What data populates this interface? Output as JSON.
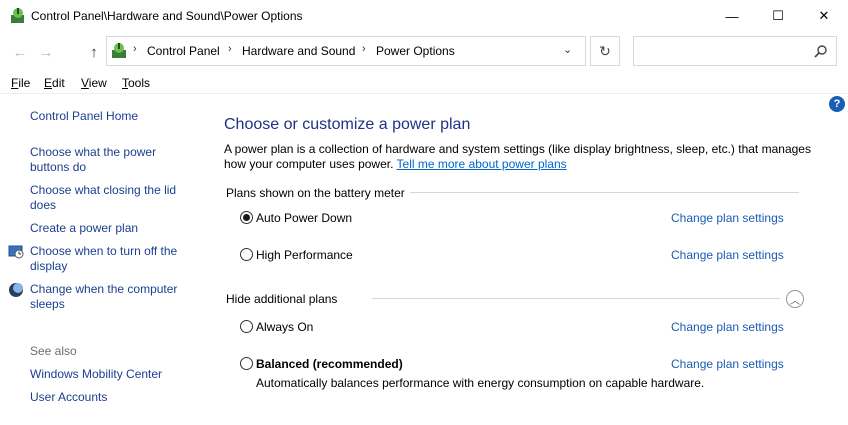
{
  "window": {
    "title": "Control Panel\\Hardware and Sound\\Power Options",
    "minimize_glyph": "—",
    "maximize_glyph": "☐",
    "close_glyph": "✕"
  },
  "nav": {
    "back_glyph": "←",
    "forward_glyph": "→",
    "up_glyph": "↑",
    "breadcrumbs": [
      "Control Panel",
      "Hardware and Sound",
      "Power Options"
    ],
    "separator": "›",
    "dropdown_glyph": "⌄",
    "refresh_glyph": "↻",
    "search_placeholder": ""
  },
  "menu": {
    "file": {
      "key": "F",
      "rest": "ile"
    },
    "edit": {
      "key": "E",
      "rest": "dit"
    },
    "view": {
      "key": "V",
      "rest": "iew"
    },
    "tools": {
      "key": "T",
      "rest": "ools"
    }
  },
  "help_glyph": "?",
  "sidebar": {
    "home": "Control Panel Home",
    "links": [
      {
        "line1": "Choose what the power",
        "line2": "buttons do"
      },
      {
        "line1": "Choose what closing the lid",
        "line2": "does"
      },
      {
        "line1": "Create a power plan",
        "line2": ""
      },
      {
        "line1": "Choose when to turn off the",
        "line2": "display"
      },
      {
        "line1": "Change when the computer",
        "line2": "sleeps"
      }
    ],
    "see_also_label": "See also",
    "see_also": [
      "Windows Mobility Center",
      "User Accounts"
    ]
  },
  "main": {
    "heading": "Choose or customize a power plan",
    "description": "A power plan is a collection of hardware and system settings (like display brightness, sleep, etc.) that manages how your computer uses power.",
    "learn_more": "Tell me more about power plans",
    "battery_group": "Plans shown on the battery meter",
    "additional_group": "Hide additional plans",
    "collapse_glyph": "︿",
    "change_link": "Change plan settings",
    "plans": [
      {
        "name": "Auto Power Down",
        "selected": true
      },
      {
        "name": "High Performance",
        "selected": false
      },
      {
        "name": "Always On",
        "selected": false
      },
      {
        "name": "Balanced (recommended)",
        "selected": false,
        "description": "Automatically balances performance with energy consumption on capable hardware."
      }
    ]
  }
}
